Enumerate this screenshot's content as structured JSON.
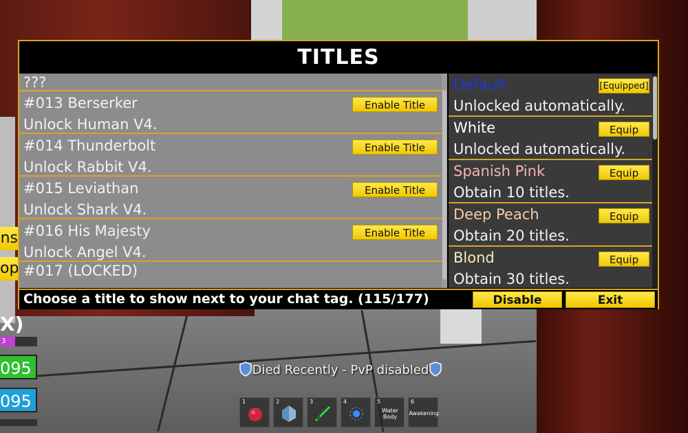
{
  "window": {
    "title": "TITLES"
  },
  "titles": [
    {
      "name": "???",
      "desc": "",
      "button": ""
    },
    {
      "name": "#013 Berserker",
      "desc": "Unlock Human V4.",
      "button": "Enable Title"
    },
    {
      "name": "#014 Thunderbolt",
      "desc": "Unlock Rabbit V4.",
      "button": "Enable Title"
    },
    {
      "name": "#015 Leviathan",
      "desc": "Unlock Shark V4.",
      "button": "Enable Title"
    },
    {
      "name": "#016 His Majesty",
      "desc": "Unlock Angel V4.",
      "button": "Enable Title"
    },
    {
      "name": "#017 (LOCKED)",
      "desc": "",
      "button": ""
    }
  ],
  "colors_list": [
    {
      "name": "Default",
      "desc": "Unlocked automatically.",
      "button": "[Equipped]",
      "color": "#1a3ad8"
    },
    {
      "name": "White",
      "desc": "Unlocked automatically.",
      "button": "Equip",
      "color": "#ffffff"
    },
    {
      "name": "Spanish Pink",
      "desc": "Obtain 10 titles.",
      "button": "Equip",
      "color": "#f4b6b0"
    },
    {
      "name": "Deep Peach",
      "desc": "Obtain 20 titles.",
      "button": "Equip",
      "color": "#f6cba4"
    },
    {
      "name": "Blond",
      "desc": "Obtain 30 titles.",
      "button": "Equip",
      "color": "#f7ebbc"
    }
  ],
  "footer": {
    "text": "Choose a title to show next to your chat tag. (115/177)",
    "disable_label": "Disable",
    "exit_label": "Exit"
  },
  "hud": {
    "tab1": "ns",
    "tab2": "op",
    "x_label": "X)",
    "level_label": "3",
    "health": "095",
    "energy": "095",
    "health_color": "#2fbf2f",
    "energy_color": "#1ea0d8"
  },
  "status": {
    "text": "Died Recently - PvP disabled"
  },
  "hotbar": [
    {
      "num": "1",
      "label": "",
      "icon": "fruit-icon"
    },
    {
      "num": "2",
      "label": "",
      "icon": "crystal-icon"
    },
    {
      "num": "3",
      "label": "",
      "icon": "sword-icon"
    },
    {
      "num": "4",
      "label": "",
      "icon": "spark-icon"
    },
    {
      "num": "5",
      "label": "Water Body",
      "icon": ""
    },
    {
      "num": "6",
      "label": "Awakening",
      "icon": ""
    }
  ]
}
